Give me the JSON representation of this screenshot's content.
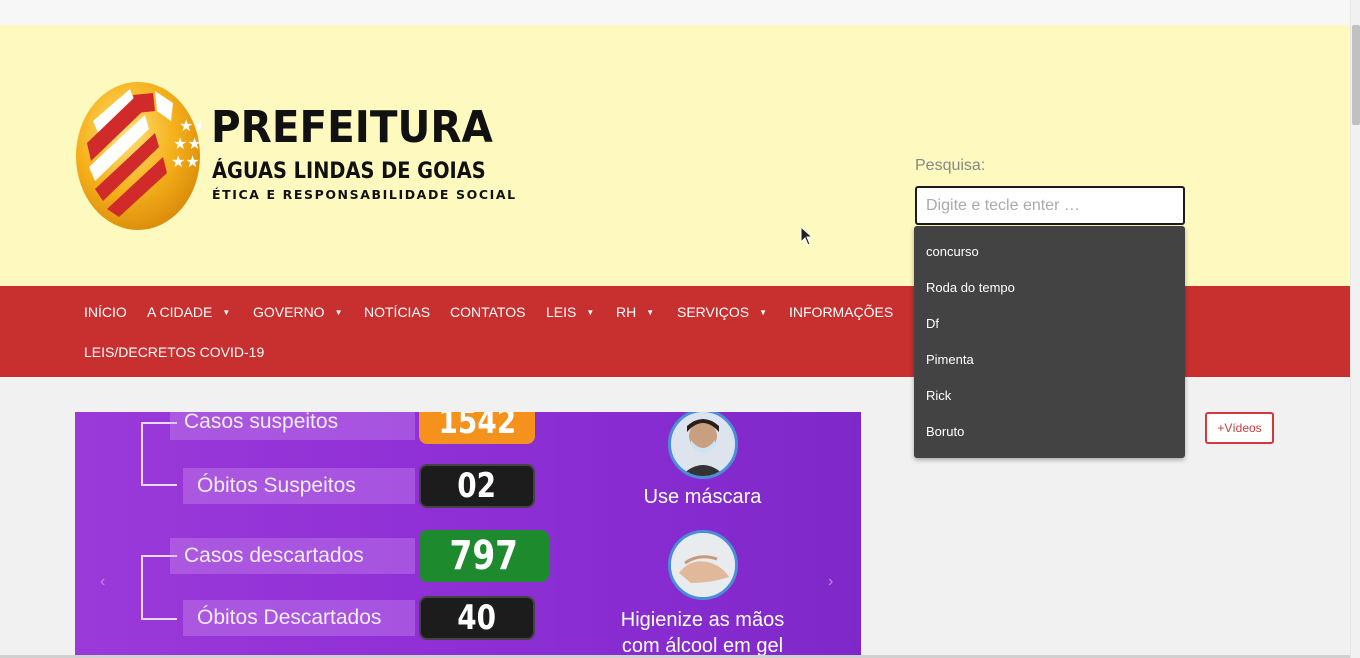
{
  "header": {
    "logo": {
      "title": "PREFEITURA",
      "city": "ÁGUAS LINDAS DE GOIAS",
      "motto": "ÉTICA E RESPONSABILIDADE SOCIAL"
    },
    "search": {
      "label": "Pesquisa:",
      "placeholder": "Digite e tecle enter …",
      "suggestions": [
        "concurso",
        "Roda do tempo",
        "Df",
        "Pimenta",
        "Rick",
        "Boruto"
      ]
    }
  },
  "nav": {
    "items": [
      {
        "label": "INÍCIO",
        "has_submenu": false
      },
      {
        "label": "A CIDADE",
        "has_submenu": true
      },
      {
        "label": "GOVERNO",
        "has_submenu": true
      },
      {
        "label": "NOTÍCIAS",
        "has_submenu": false
      },
      {
        "label": "CONTATOS",
        "has_submenu": false
      },
      {
        "label": "LEIS",
        "has_submenu": true
      },
      {
        "label": "RH",
        "has_submenu": true
      },
      {
        "label": "SERVIÇOS",
        "has_submenu": true
      },
      {
        "label": "INFORMAÇÕES",
        "has_submenu": false
      },
      {
        "label": "LEIS/DECRETOS COVID-19",
        "has_submenu": false
      }
    ],
    "caret": "▼"
  },
  "slider": {
    "stats": [
      {
        "label": "Casos suspeitos",
        "value": "1542",
        "color": "#f5921e"
      },
      {
        "label": "Óbitos Suspeitos",
        "value": "02",
        "color": "#1c1c1c"
      },
      {
        "label": "Casos descartados",
        "value": "797",
        "color": "#1e8a2e"
      },
      {
        "label": "Óbitos Descartados",
        "value": "40",
        "color": "#1c1c1c"
      }
    ],
    "tips": [
      "Use máscara",
      "Higienize as mãos\ncom álcool em gel"
    ],
    "prev_arrow": "‹",
    "next_arrow": "›"
  },
  "sidebar": {
    "videos_button": "+Vídeos"
  },
  "colors": {
    "header_bg": "#fdf9bf",
    "nav_bg": "#c82f2f",
    "slider_bg": "#8e2fd6",
    "dropdown_bg": "#434343",
    "accent_red": "#d23a3a"
  }
}
